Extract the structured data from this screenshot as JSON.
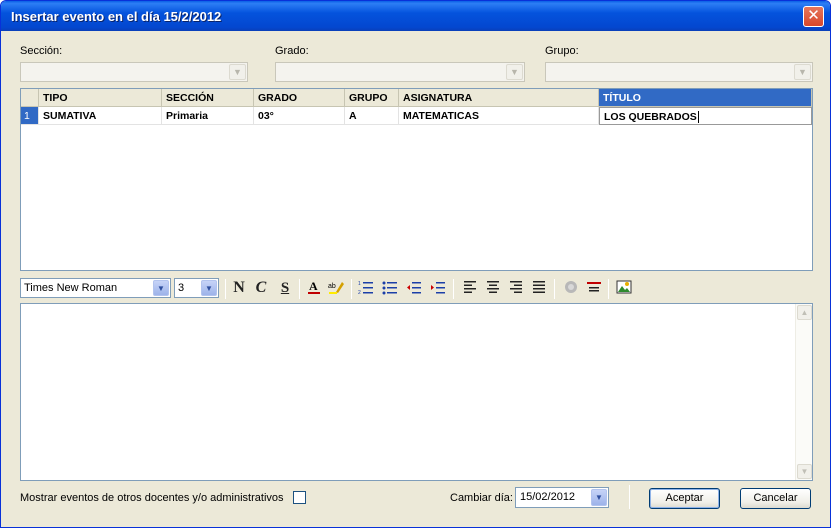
{
  "window": {
    "title": "Insertar evento en el día 15/2/2012",
    "close_glyph": "✕"
  },
  "filters": {
    "seccion_label": "Sección:",
    "grado_label": "Grado:",
    "grupo_label": "Grupo:",
    "seccion_value": "",
    "grado_value": "",
    "grupo_value": ""
  },
  "grid": {
    "columns": [
      "TIPO",
      "SECCIÓN",
      "GRADO",
      "GRUPO",
      "ASIGNATURA",
      "TÍTULO"
    ],
    "rows": [
      {
        "num": "1",
        "tipo": "SUMATIVA",
        "seccion": "Primaria",
        "grado": "03°",
        "grupo": "A",
        "asignatura": "MATEMATICAS",
        "titulo": "LOS QUEBRADOS"
      }
    ]
  },
  "toolbar": {
    "font_family": "Times New Roman",
    "font_size": "3",
    "bold": "N",
    "italic": "C",
    "underline": "S",
    "icons": [
      "font-color-icon",
      "highlight-icon",
      "numbered-list-icon",
      "bullet-list-icon",
      "outdent-icon",
      "indent-icon",
      "align-left-icon",
      "align-center-icon",
      "align-right-icon",
      "justify-icon",
      "link-icon",
      "horizontal-rule-icon",
      "insert-image-icon"
    ]
  },
  "footer": {
    "show_others_label": "Mostrar eventos de otros docentes y/o administrativos",
    "change_day_label": "Cambiar día:",
    "date_value": "15/02/2012",
    "accept_label": "Aceptar",
    "cancel_label": "Cancelar"
  }
}
